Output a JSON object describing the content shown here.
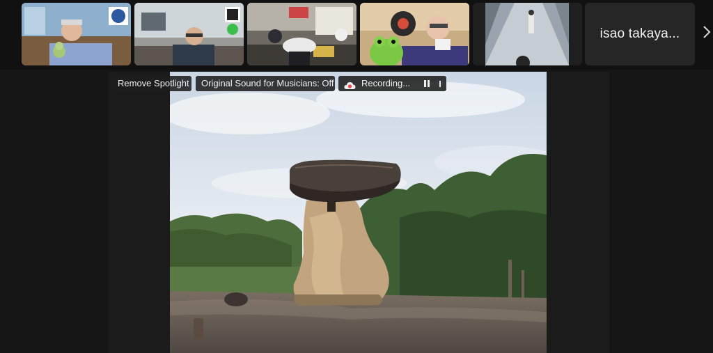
{
  "gallery": {
    "participant_name": "isao takaya...",
    "next_icon": "chevron-right-icon",
    "tiles": [
      {
        "id": "participant-1"
      },
      {
        "id": "participant-2"
      },
      {
        "id": "participant-3"
      },
      {
        "id": "participant-4"
      },
      {
        "id": "participant-5"
      }
    ]
  },
  "spotlight": {
    "remove_spotlight_label": "Remove Spotlight",
    "original_sound_label": "Original Sound for Musicians: Off",
    "recording_label": "Recording...",
    "recording_icon": "cloud-record-icon",
    "pause_icon": "pause-icon",
    "stop_icon": "stop-icon"
  },
  "colors": {
    "background": "#161616",
    "pill_background": "#1e1e1e",
    "recording_red": "#e5484d"
  }
}
